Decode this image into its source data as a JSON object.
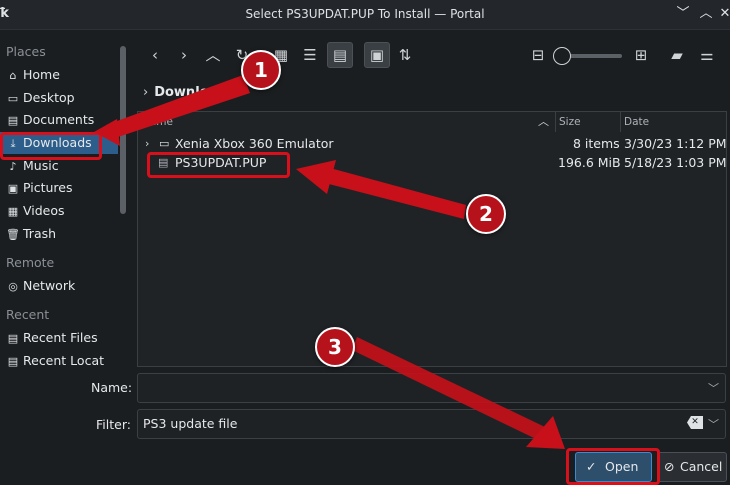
{
  "window": {
    "title": "Select PS3UPDAT.PUP To Install — Portal",
    "icon": "kde-icon",
    "controls": [
      "minimize",
      "maximize",
      "close"
    ]
  },
  "sidebar": {
    "places_header": "Places",
    "places": [
      {
        "label": "Home",
        "icon": "home-icon"
      },
      {
        "label": "Desktop",
        "icon": "desktop-icon"
      },
      {
        "label": "Documents",
        "icon": "documents-icon"
      },
      {
        "label": "Downloads",
        "icon": "downloads-icon",
        "active": true
      },
      {
        "label": "Music",
        "icon": "music-icon"
      },
      {
        "label": "Pictures",
        "icon": "pictures-icon"
      },
      {
        "label": "Videos",
        "icon": "videos-icon"
      },
      {
        "label": "Trash",
        "icon": "trash-icon"
      }
    ],
    "remote_header": "Remote",
    "remote": [
      {
        "label": "Network",
        "icon": "network-icon"
      }
    ],
    "recent_header": "Recent",
    "recent": [
      {
        "label": "Recent Files",
        "icon": "recent-files-icon"
      },
      {
        "label": "Recent Locat",
        "icon": "recent-locations-icon"
      }
    ]
  },
  "breadcrumb": {
    "current": "Downloads"
  },
  "file_view": {
    "columns": {
      "name": "Name",
      "size": "Size",
      "date": "Date"
    },
    "rows": [
      {
        "name": "Xenia Xbox 360 Emulator",
        "size": "8 items",
        "date": "3/30/23 1:12 PM",
        "type": "folder"
      },
      {
        "name": "PS3UPDAT.PUP",
        "size": "196.6 MiB",
        "date": "5/18/23 1:03 PM",
        "type": "file"
      }
    ]
  },
  "name_field": {
    "label": "Name:",
    "value": ""
  },
  "filter_field": {
    "label": "Filter:",
    "value": "PS3 update file"
  },
  "buttons": {
    "open": "Open",
    "cancel": "Cancel"
  },
  "annotations": [
    "1",
    "2",
    "3"
  ],
  "colors": {
    "accent": "#2d5d8a",
    "annotation_red": "#d8101c",
    "background": "#1b1e20"
  }
}
